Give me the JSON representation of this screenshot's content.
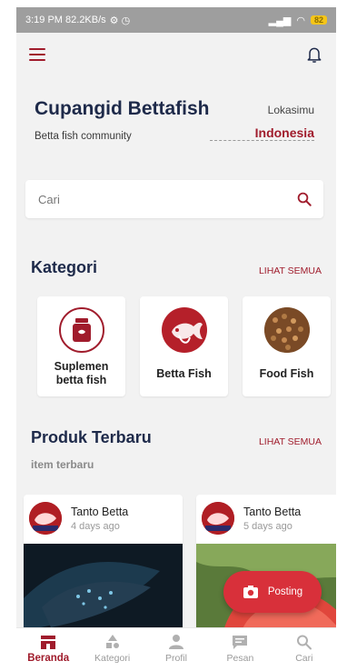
{
  "status_bar": {
    "time_speed": "3:19 PM 82.2KB/s",
    "battery": "82"
  },
  "header": {
    "brand": "Cupangid Bettafish",
    "tagline": "Betta fish community",
    "location_label": "Lokasimu",
    "location_value": "Indonesia"
  },
  "search": {
    "placeholder": "Cari"
  },
  "categories": {
    "title": "Kategori",
    "see_all": "LIHAT SEMUA",
    "items": [
      {
        "label": "Suplemen betta fish",
        "icon": "supplement-jar-icon"
      },
      {
        "label": "Betta Fish",
        "icon": "betta-fish-icon"
      },
      {
        "label": "Food Fish",
        "icon": "fish-food-pellets-icon"
      }
    ]
  },
  "products": {
    "title": "Produk Terbaru",
    "see_all": "LIHAT SEMUA",
    "subtitle": "item terbaru",
    "items": [
      {
        "seller": "Tanto Betta",
        "ago": "4 days ago"
      },
      {
        "seller": "Tanto Betta",
        "ago": "5 days ago"
      }
    ]
  },
  "fab": {
    "label": "Posting"
  },
  "bottom_nav": [
    {
      "label": "Beranda",
      "active": true
    },
    {
      "label": "Kategori",
      "active": false
    },
    {
      "label": "Profil",
      "active": false
    },
    {
      "label": "Pesan",
      "active": false
    },
    {
      "label": "Cari",
      "active": false
    }
  ],
  "colors": {
    "accent": "#a01c2c",
    "title": "#1e2a4a",
    "background": "#f2f2f2",
    "fab": "#d8303a"
  }
}
